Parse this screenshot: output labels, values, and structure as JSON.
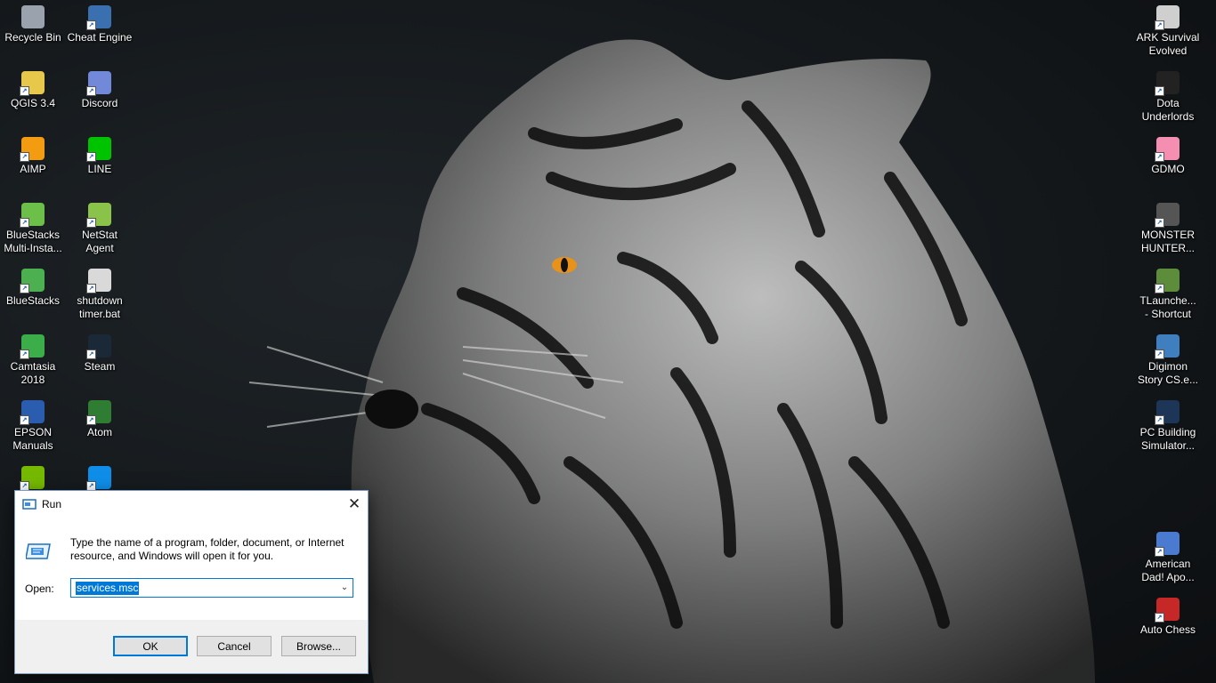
{
  "desktop": {
    "left_column_1": [
      {
        "label": "Recycle Bin",
        "icon": "recycle-bin-icon",
        "color": "#9aa3ad"
      },
      {
        "label": "QGIS 3.4",
        "icon": "qgis-icon",
        "color": "#e8c84a"
      },
      {
        "label": "AIMP",
        "icon": "aimp-icon",
        "color": "#f39c12"
      },
      {
        "label": "BlueStacks\nMulti-Insta...",
        "icon": "bluestacks-multi-instance-icon",
        "color": "#6cc04a"
      },
      {
        "label": "BlueStacks",
        "icon": "bluestacks-icon",
        "color": "#4caf50"
      },
      {
        "label": "Camtasia\n2018",
        "icon": "camtasia-icon",
        "color": "#3cae49"
      },
      {
        "label": "EPSON\nManuals",
        "icon": "epson-manuals-icon",
        "color": "#2a5db0"
      },
      {
        "label": "",
        "icon": "nvidia-icon",
        "color": "#76b900"
      }
    ],
    "left_column_2": [
      {
        "label": "Cheat Engine",
        "icon": "cheat-engine-icon",
        "color": "#3a6fb0"
      },
      {
        "label": "Discord",
        "icon": "discord-icon",
        "color": "#7289da"
      },
      {
        "label": "LINE",
        "icon": "line-icon",
        "color": "#00c300"
      },
      {
        "label": "NetStat\nAgent",
        "icon": "netstat-agent-icon",
        "color": "#8bc34a"
      },
      {
        "label": "shutdown\ntimer.bat",
        "icon": "bat-file-icon",
        "color": "#d9d9d9"
      },
      {
        "label": "Steam",
        "icon": "steam-icon",
        "color": "#1b2838"
      },
      {
        "label": "Atom",
        "icon": "atom-icon",
        "color": "#2e7d32"
      },
      {
        "label": "",
        "icon": "teamviewer-icon",
        "color": "#0e8ee9"
      }
    ],
    "right_column": [
      {
        "label": "ARK Survival\nEvolved",
        "icon": "ark-survival-icon",
        "color": "#cfcfcf"
      },
      {
        "label": "Dota\nUnderlords",
        "icon": "dota-underlords-icon",
        "color": "#222222"
      },
      {
        "label": "GDMO",
        "icon": "gdmo-icon",
        "color": "#f48fb1"
      },
      {
        "label": "MONSTER\nHUNTER...",
        "icon": "monster-hunter-icon",
        "color": "#555555"
      },
      {
        "label": "TLaunche...\n- Shortcut",
        "icon": "tlauncher-icon",
        "color": "#5d8c3a"
      },
      {
        "label": "Digimon\nStory CS.e...",
        "icon": "digimon-icon",
        "color": "#3f7fbf"
      },
      {
        "label": "PC Building\nSimulator...",
        "icon": "pc-building-simulator-icon",
        "color": "#1d3557"
      },
      {
        "label": "American\nDad! Apo...",
        "icon": "american-dad-icon",
        "color": "#4a7bd0"
      },
      {
        "label": "Auto Chess",
        "icon": "auto-chess-icon",
        "color": "#c62828"
      }
    ]
  },
  "run_dialog": {
    "title": "Run",
    "description": "Type the name of a program, folder, document, or Internet resource, and Windows will open it for you.",
    "open_label": "Open:",
    "open_value": "services.msc",
    "ok_label": "OK",
    "cancel_label": "Cancel",
    "browse_label": "Browse...",
    "close_glyph": "✕"
  },
  "colors": {
    "accent": "#0078d7",
    "dialog_bg": "#f0f0f0"
  }
}
